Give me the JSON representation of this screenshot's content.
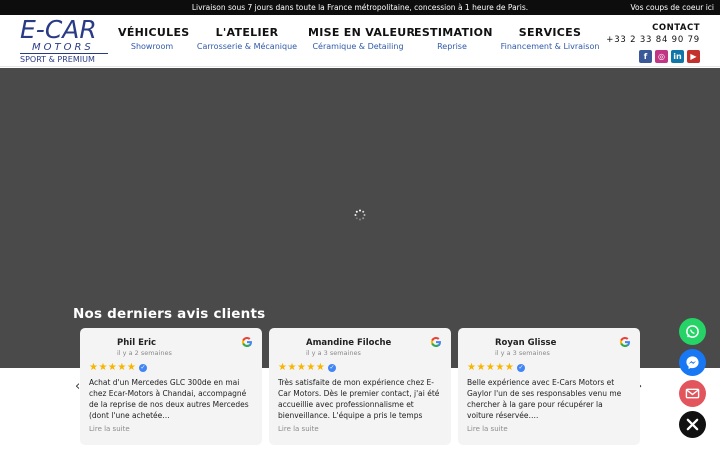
{
  "topbar": {
    "message": "Livraison sous 7 jours dans toute la France métropolitaine, concession à 1 heure de Paris.",
    "right_link": "Vos coups de coeur ici"
  },
  "logo": {
    "line1": "E-CAR",
    "line2": "MOTORS",
    "line3": "SPORT & PREMIUM"
  },
  "nav": [
    {
      "title": "VÉHICULES",
      "sub": "Showroom"
    },
    {
      "title": "L'ATELIER",
      "sub": "Carrosserie & Mécanique"
    },
    {
      "title": "MISE EN VALEUR",
      "sub": "Céramique & Detailing"
    },
    {
      "title": "ESTIMATION",
      "sub": "Reprise"
    },
    {
      "title": "SERVICES",
      "sub": "Financement & Livraison"
    }
  ],
  "contact": {
    "label": "CONTACT",
    "phone": "+33 2 33 84 90 79"
  },
  "socials": [
    {
      "icon": "facebook-icon",
      "glyph": "f",
      "color": "#3b5998"
    },
    {
      "icon": "instagram-icon",
      "glyph": "◎",
      "color": "#c13584"
    },
    {
      "icon": "linkedin-icon",
      "glyph": "in",
      "color": "#0e76a8"
    },
    {
      "icon": "youtube-icon",
      "glyph": "▶",
      "color": "#c4302b"
    }
  ],
  "reviews": {
    "title": "Nos derniers avis clients",
    "stars": "★★★★★",
    "read_more": "Lire la suite",
    "items": [
      {
        "name": "Phil Eric",
        "date": "il y a 2 semaines",
        "text": "Achat d'un Mercedes GLC 300de en mai chez Ecar-Motors à Chandai, accompagné de la reprise de nos deux autres Mercedes (dont l'une achetée…"
      },
      {
        "name": "Amandine Filoche",
        "date": "il y a 3 semaines",
        "text": "Très satisfaite de mon expérience chez E-Car Motors. Dès le premier contact, j'ai été accueillie avec professionnalisme et bienveillance. L'équipe a pris le temps de…"
      },
      {
        "name": "Royan Glisse",
        "date": "il y a 3 semaines",
        "text": "Belle expérience avec E-Cars Motors et Gaylor l'un de ses responsables venu me chercher à la gare pour récupérer la voiture réservée…."
      }
    ]
  },
  "colors": {
    "brand": "#2a3b86",
    "accent": "#2f5aa8",
    "hero": "#4a4a4a",
    "star": "#f7b500",
    "whatsapp": "#25d366",
    "messenger": "#1877f2",
    "email": "#e2555d",
    "close": "#111111"
  },
  "fabs": [
    "whatsapp-icon",
    "messenger-icon",
    "email-icon",
    "close-icon"
  ]
}
